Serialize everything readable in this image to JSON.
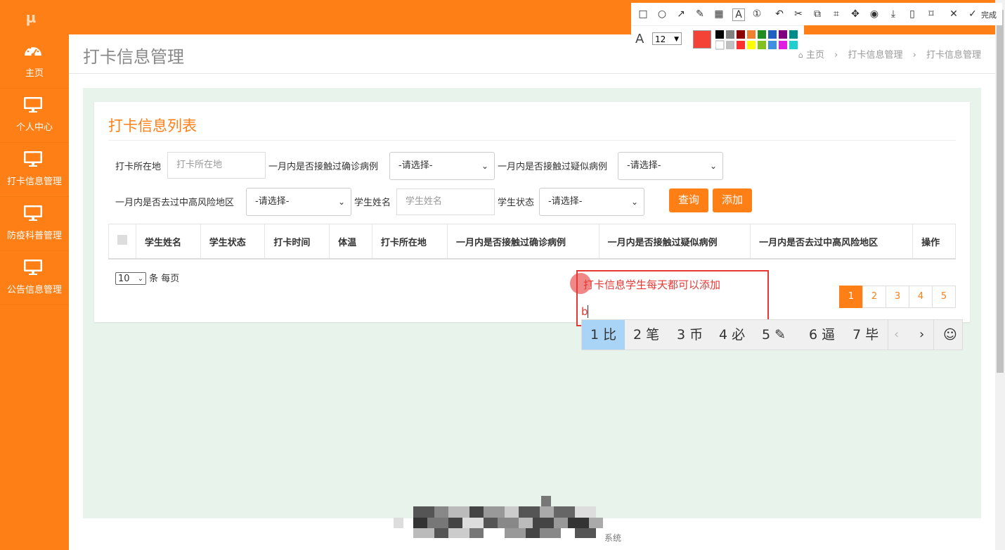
{
  "sidebar": {
    "items": [
      {
        "label": "主页",
        "icon": "dashboard-icon"
      },
      {
        "label": "个人中心",
        "icon": "monitor-icon"
      },
      {
        "label": "打卡信息管理",
        "icon": "monitor-icon"
      },
      {
        "label": "防疫科普管理",
        "icon": "monitor-icon"
      },
      {
        "label": "公告信息管理",
        "icon": "monitor-icon"
      }
    ]
  },
  "header": {
    "title": "打卡信息管理",
    "breadcrumb": {
      "home": "主页",
      "sep": "›",
      "level1": "打卡信息管理",
      "level2": "打卡信息管理"
    }
  },
  "card": {
    "title": "打卡信息列表",
    "filters": {
      "location_label": "打卡所在地",
      "location_placeholder": "打卡所在地",
      "confirmed_label": "一月内是否接触过确诊病例",
      "suspected_label": "一月内是否接触过疑似病例",
      "risk_label": "一月内是否去过中高风险地区",
      "name_label": "学生姓名",
      "name_placeholder": "学生姓名",
      "status_label": "学生状态",
      "select_default": "-请选择-"
    },
    "buttons": {
      "search": "查询",
      "add": "添加"
    },
    "table": {
      "headers": [
        "学生姓名",
        "学生状态",
        "打卡时间",
        "体温",
        "打卡所在地",
        "一月内是否接触过确诊病例",
        "一月内是否接触过疑似病例",
        "一月内是否去过中高风险地区",
        "操作"
      ]
    },
    "page_size": {
      "value": "10",
      "suffix": "条 每页"
    },
    "pagination": [
      "1",
      "2",
      "3",
      "4",
      "5"
    ],
    "current_page": "1"
  },
  "footer": {
    "text": "系统"
  },
  "annotation": {
    "text": "打卡信息学生每天都可以添加",
    "typing": "b",
    "color": "#e53935"
  },
  "screenshot_toolbar": {
    "done_label": "完成",
    "font_size": "12",
    "selected_color": "#f44336"
  },
  "ime": {
    "candidates": [
      {
        "n": "1",
        "c": "比"
      },
      {
        "n": "2",
        "c": "笔"
      },
      {
        "n": "3",
        "c": "币"
      },
      {
        "n": "4",
        "c": "必"
      },
      {
        "n": "5",
        "c": "✎"
      },
      {
        "n": "6",
        "c": "逼"
      },
      {
        "n": "7",
        "c": "毕"
      }
    ]
  },
  "colors": {
    "brand": "#ff7f17",
    "content_bg": "#e8f3ec"
  }
}
